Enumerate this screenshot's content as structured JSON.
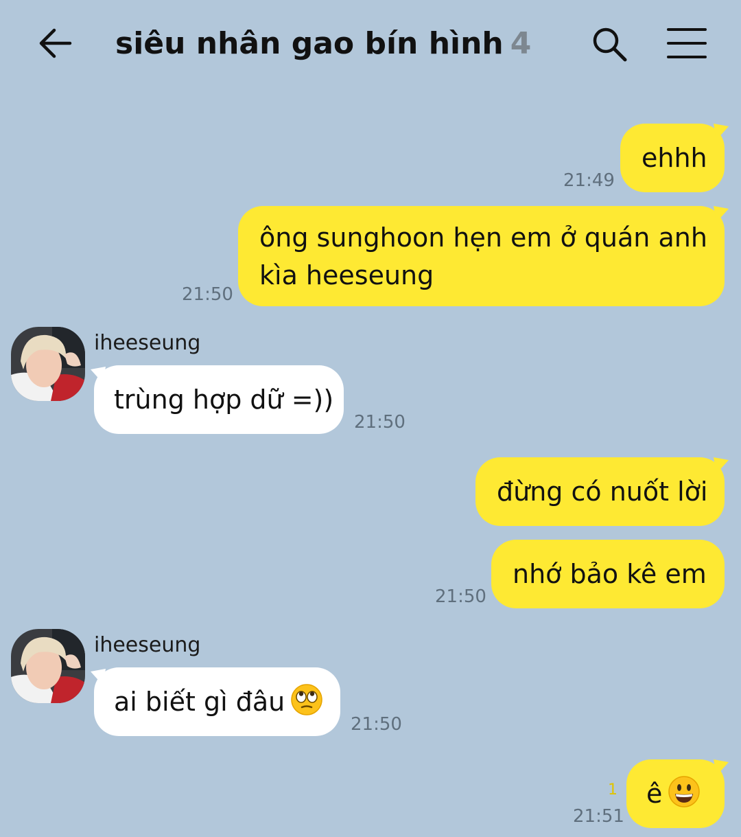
{
  "header": {
    "title": "siêu nhân gao bín hình",
    "member_count": "4"
  },
  "messages": [
    {
      "from": "me",
      "text": "ehhh",
      "time": "21:49"
    },
    {
      "from": "me",
      "lines": [
        "ông sunghoon hẹn em ở quán anh",
        "kìa heeseung"
      ],
      "time": "21:50"
    },
    {
      "from": "iheeseung",
      "sender": "iheeseung",
      "text": "trùng hợp dữ =))",
      "time": "21:50"
    },
    {
      "from": "me",
      "text": "đừng có nuốt lời"
    },
    {
      "from": "me",
      "text": "nhớ bảo kê em",
      "time": "21:50"
    },
    {
      "from": "iheeseung",
      "sender": "iheeseung",
      "text": "ai biết gì đâu",
      "emoji": "face-with-rolling-eyes",
      "time": "21:50"
    },
    {
      "from": "me",
      "text": "ê",
      "emoji": "grinning-face",
      "unread": "1",
      "time": "21:51"
    }
  ],
  "colors": {
    "background": "#b2c7da",
    "my_bubble": "#fee933",
    "their_bubble": "#ffffff",
    "unread": "#e0c400"
  }
}
